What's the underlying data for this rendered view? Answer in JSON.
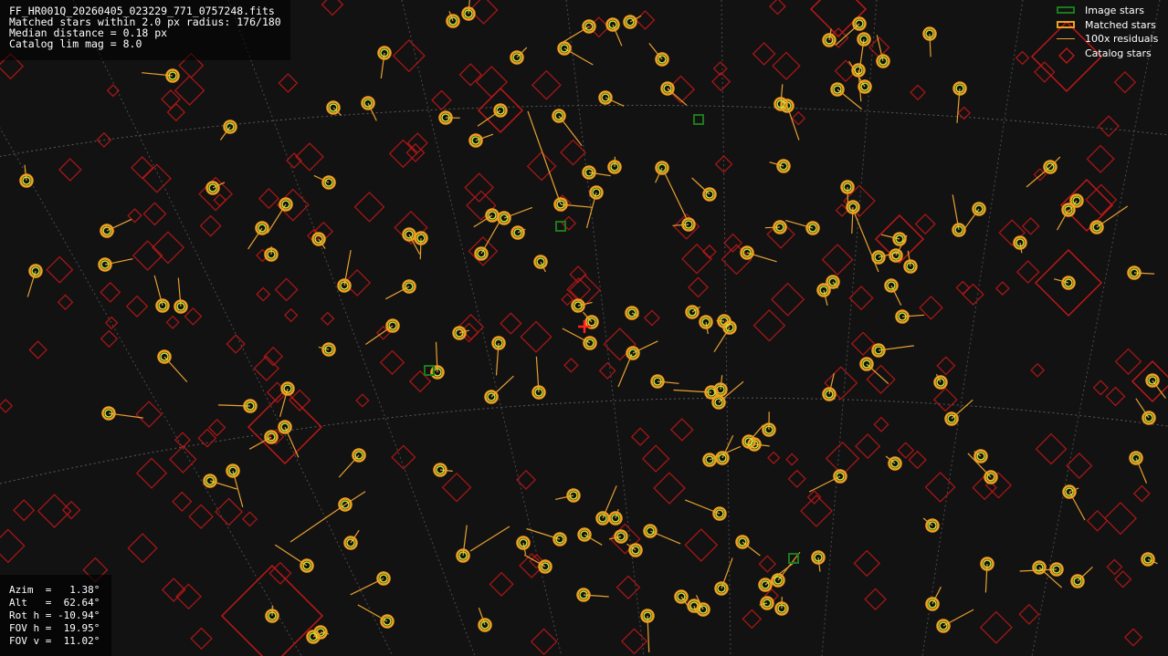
{
  "info": {
    "filename": "FF_HR001Q_20260405_023229_771_0757248.fits",
    "matched": "Matched stars within 2.0 px radius: 176/180",
    "median": "Median distance = 0.18 px",
    "catalog": "Catalog lim mag = 8.0"
  },
  "legend": {
    "image_stars": "Image stars",
    "matched_stars": "Matched stars",
    "residuals": "100x residuals",
    "catalog_stars": "Catalog stars"
  },
  "pointing": {
    "azim": "Azim  =   1.38°",
    "alt": "Alt   =  62.64°",
    "roth": "Rot h = -10.94°",
    "fovh": "FOV h =  19.95°",
    "fovv": "FOV v =  11.02°"
  },
  "colors": {
    "background": "#121212",
    "image_star": "#1b7a1b",
    "matched_star": "#f0a020",
    "residual": "#e8a030",
    "catalog_star": "#c01818",
    "marker_inner": "#c8e83a",
    "grid": "#7a7a7a",
    "center_mark": "#ff2020"
  },
  "icons": {
    "center": "cross-icon",
    "catalog": "diamond-icon",
    "image": "square-icon",
    "matched": "ring-icon"
  }
}
